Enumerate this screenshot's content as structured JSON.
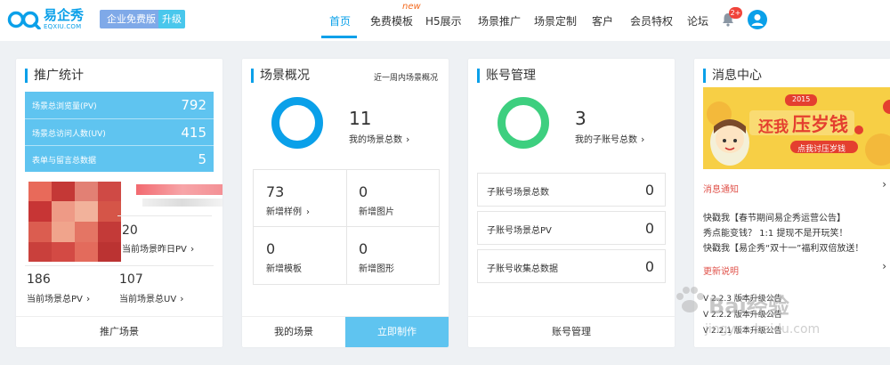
{
  "header": {
    "logo_cn": "易企秀",
    "logo_en": "EQXIU.COM",
    "free_badge": "企业免费版",
    "upgrade_badge": "升级",
    "new_tag": "new",
    "nav": [
      "首页",
      "免费模板",
      "H5展示",
      "场景推广",
      "场景定制",
      "客户",
      "会员特权",
      "论坛"
    ],
    "active_nav": "首页",
    "notification_count": "2+"
  },
  "promo_stats": {
    "title": "推广统计",
    "rows": [
      {
        "label": "场景总浏览量(PV)",
        "value": "792"
      },
      {
        "label": "场景总访问人数(UV)",
        "value": "415"
      },
      {
        "label": "表单与留言总数据",
        "value": "5"
      }
    ],
    "yesterday_value": "20",
    "yesterday_label": "当前场景昨日PV",
    "current_pv_value": "186",
    "current_pv_label": "当前场景总PV",
    "current_uv_value": "107",
    "current_uv_label": "当前场景总UV",
    "footer_button": "推广场景"
  },
  "scene_overview": {
    "title": "场景概况",
    "subtitle": "近一周内场景概况",
    "total_value": "11",
    "total_label": "我的场景总数",
    "cells": [
      {
        "value": "73",
        "label": "新增样例"
      },
      {
        "value": "0",
        "label": "新增图片"
      },
      {
        "value": "0",
        "label": "新增模板"
      },
      {
        "value": "0",
        "label": "新增图形"
      }
    ],
    "footer_left": "我的场景",
    "footer_right": "立即制作"
  },
  "account_mgmt": {
    "title": "账号管理",
    "sub_total_value": "3",
    "sub_total_label": "我的子账号总数",
    "rows": [
      {
        "label": "子账号场景总数",
        "value": "0"
      },
      {
        "label": "子账号场景总PV",
        "value": "0"
      },
      {
        "label": "子账号收集总数据",
        "value": "0"
      }
    ],
    "footer_button": "账号管理"
  },
  "messages": {
    "title": "消息中心",
    "banner_top": "2015",
    "banner_title_a": "还我",
    "banner_title_b": "压岁钱",
    "banner_button": "点我讨压岁钱",
    "notice_head": "消息通知",
    "notices": [
      "快戳我【春节期间易企秀运营公告】",
      "秀点能变钱？ 1:1 提现不是开玩笑！",
      "快戳我【易企秀“双十一”福利双倍放送！"
    ],
    "update_head": "更新说明",
    "versions": [
      "V 2.2.3 版本升级公告",
      "V 2.2.2 版本升级公告",
      "V 2.2.1 版本升级公告"
    ]
  },
  "watermark": {
    "text": "Bai经验",
    "url": "jingyan.baidu.com"
  },
  "colors": {
    "brand": "#0aa0e9",
    "stat_bg": "#5fc4f0",
    "green_ring": "#3dcf7f",
    "accent_red": "#e0534b"
  }
}
